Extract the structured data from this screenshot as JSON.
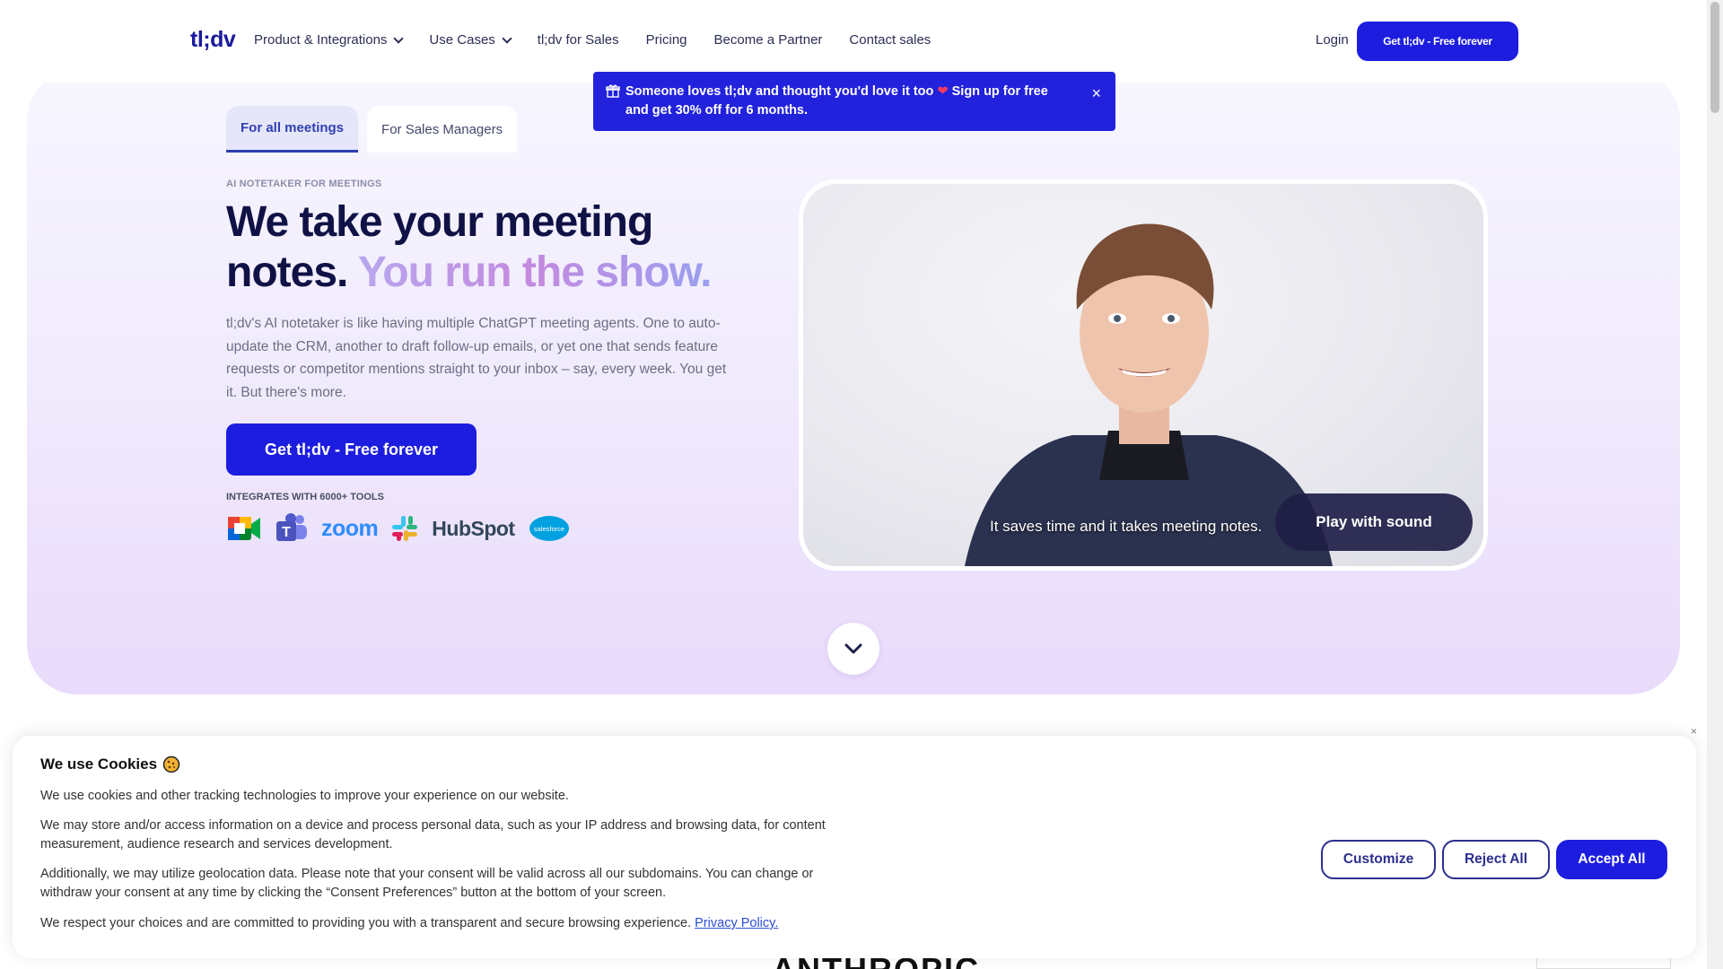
{
  "nav": {
    "logo": "tl;dv",
    "links": [
      "Product & Integrations",
      "Use Cases",
      "tl;dv for Sales",
      "Pricing",
      "Become a Partner",
      "Contact sales"
    ],
    "login": "Login",
    "cta": "Get tl;dv - Free forever"
  },
  "banner": {
    "text": "Someone loves tl;dv and thought you'd love it too",
    "text2": "Sign up for free",
    "text3": "and get 30% off for 6 months.",
    "close": "×",
    "gift_icon": "gift-icon",
    "heart_icon": "heart-icon"
  },
  "hero": {
    "tabs": [
      "For all meetings",
      "For Sales Managers"
    ],
    "active_tab": "For all meetings",
    "kicker": "AI NOTETAKER FOR MEETINGS",
    "headline_part1": "We take your meeting notes.",
    "headline_part2": "You run the show.",
    "description": "tl;dv's AI notetaker is like having multiple ChatGPT meeting agents. One to auto-update the CRM, another to draft follow-up emails, or yet one that sends feature requests or competitor mentions straight to your inbox – say, every week. You get it. But there's more.",
    "cta": "Get tl;dv - Free forever",
    "integrations_label": "INTEGRATES WITH 6000+ TOOLS",
    "integrations": [
      "Google Meet",
      "Microsoft Teams",
      "zoom",
      "Slack",
      "HubSpot",
      "salesforce"
    ]
  },
  "video": {
    "caption": "It saves time and it takes meeting notes.",
    "play_label": "Play with sound"
  },
  "scroll_down_icon": "chevron-down-icon",
  "below": {
    "partial_text": "ANTHROPIC"
  },
  "cookie": {
    "title": "We use Cookies",
    "icon": "cookie-icon",
    "p1": "We use cookies and other tracking technologies to improve your experience on our website.",
    "p2": "We may store and/or access information on a device and process personal data, such as your IP address and browsing data, for content measurement, audience research and services development.",
    "p3": "Additionally, we may utilize geolocation data. Please note that your consent will be valid across all our subdomains. You can change or withdraw your consent at any time by clicking the “Consent Preferences” button at the bottom of your screen.",
    "p4": "We respect your choices and are committed to providing you with a transparent and secure browsing experience.",
    "privacy_link": "Privacy Policy.",
    "customize": "Customize",
    "reject": "Reject All",
    "accept": "Accept All",
    "close": "×"
  },
  "colors": {
    "brand": "#1d1de0",
    "headline": "#101246",
    "hero_bg": "#f1ecfd"
  }
}
